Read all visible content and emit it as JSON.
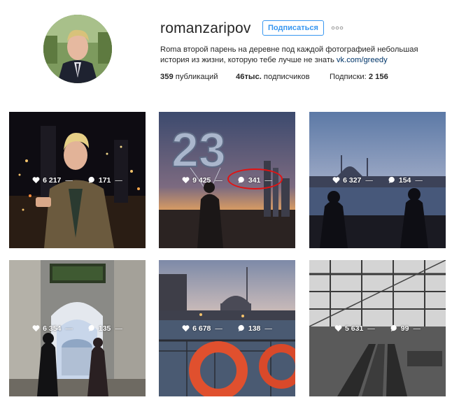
{
  "profile": {
    "username": "romanzaripov",
    "follow_label": "Подписаться",
    "more_icon": "ellipsis-icon",
    "bio_text": "Roma второй парень на деревне под каждой фотографией небольшая история из жизни, которую тебе лучше не знать ",
    "bio_link": "vk.com/greedy",
    "stats": {
      "posts_count": "359",
      "posts_label": " публикаций",
      "followers_count": "46тыс.",
      "followers_label": " подписчиков",
      "following_label": "Подписки: ",
      "following_count": "2 156"
    }
  },
  "posts": [
    {
      "likes": "6 217",
      "comments": "171",
      "dash": "—",
      "scene": "night-city-portrait"
    },
    {
      "likes": "9 425",
      "comments": "341",
      "dash": "—",
      "scene": "balloons-23-sunset"
    },
    {
      "likes": "6 327",
      "comments": "154",
      "dash": "—",
      "scene": "istanbul-silhouette"
    },
    {
      "likes": "6 354",
      "comments": "135",
      "dash": "—",
      "scene": "mosque-arch"
    },
    {
      "likes": "6 678",
      "comments": "138",
      "dash": "—",
      "scene": "bosphorus-lifebuoy"
    },
    {
      "likes": "5 631",
      "comments": "99",
      "dash": "—",
      "scene": "station-escalator"
    }
  ],
  "colors": {
    "accent": "#3897f0",
    "link": "#003569",
    "highlight": "#e21212"
  }
}
